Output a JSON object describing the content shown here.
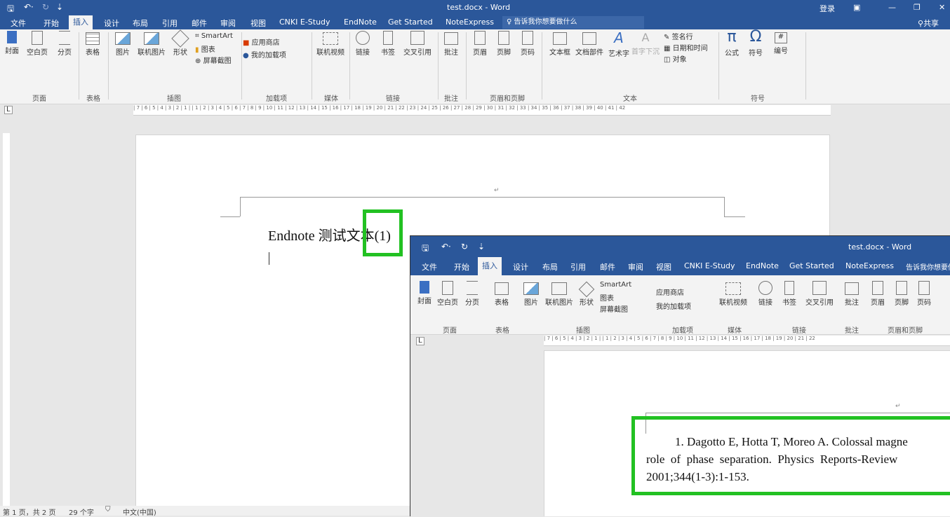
{
  "window": {
    "title": "test.docx - Word",
    "login": "登录",
    "share": "共享"
  },
  "tabs": [
    "文件",
    "开始",
    "插入",
    "设计",
    "布局",
    "引用",
    "邮件",
    "审阅",
    "视图",
    "CNKI E-Study",
    "EndNote",
    "Get Started",
    "NoteExpress"
  ],
  "active_tab": "插入",
  "tell_me": "告诉我你想要做什么",
  "ribbon": {
    "buttons": {
      "cover": "封面",
      "blank": "空白页",
      "break": "分页",
      "table": "表格",
      "picture": "图片",
      "online_picture": "联机图片",
      "shapes": "形状",
      "smartart": "SmartArt",
      "chart": "图表",
      "screenshot": "屏幕截图",
      "store": "应用商店",
      "my_addins": "我的加载项",
      "online_video": "联机视频",
      "link": "链接",
      "bookmark": "书签",
      "crossref": "交叉引用",
      "comment": "批注",
      "header": "页眉",
      "footer": "页脚",
      "page_number": "页码",
      "textbox": "文本框",
      "quickparts": "文档部件",
      "wordart": "艺术字",
      "dropcap": "首字下沉",
      "signature": "签名行",
      "datetime": "日期和时间",
      "object": "对象",
      "equation": "公式",
      "symbol": "符号",
      "numbering": "编号"
    },
    "groups": {
      "pages": "页面",
      "tables": "表格",
      "illustrations": "插图",
      "addins": "加载项",
      "media": "媒体",
      "links": "链接",
      "comments": "批注",
      "header_footer": "页眉和页脚",
      "text": "文本",
      "symbols": "符号"
    }
  },
  "ruler_text": "| 7 | 6 | 5 | 4 | 3 | 2 | 1 |  | 1 | 2 | 3 | 4 | 5 | 6 | 7 | 8 | 9 | 10 | 11 | 12 | 13 | 14 | 15 | 16 | 17 | 18 | 19 | 20 | 21 | 22 | 23 | 24 | 25 | 26 | 27 | 28 | 29 | 30 | 31 | 32 | 33 | 34 | 35 | 36 | 37 | 38 | 39 | 40 | 41 | 42",
  "ruler_text_inner": "| 7 | 6 | 5 | 4 | 3 | 2 | 1 |  | 1 | 2 | 3 | 4 | 5 | 6 | 7 | 8 | 9 | 10 | 11 | 12 | 13 | 14 | 15 | 16 | 17 | 18 | 19 | 20 | 21 | 22",
  "document": {
    "main_text": "Endnote 测试文本(1)",
    "paragraph_mark": "↵",
    "reference_line1": "1.  Dagotto E, Hotta T, Moreo A. Colossal magne",
    "reference_line2": "role  of  phase  separation.  Physics  Reports-Review",
    "reference_line3": "2001;344(1-3):1-153."
  },
  "status": {
    "page": "第 1 页，共 2 页",
    "words": "29 个字",
    "lang": "中文(中国)"
  },
  "colors": {
    "word_blue": "#2b579a",
    "highlight_green": "#22c122"
  }
}
